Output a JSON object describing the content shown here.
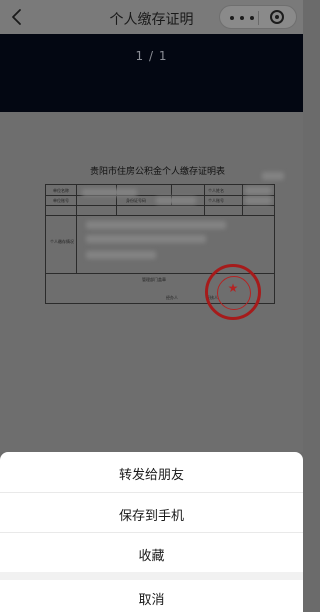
{
  "navbar": {
    "title": "个人缴存证明"
  },
  "viewer": {
    "page_counter": "1 / 1"
  },
  "document": {
    "title": "贵阳市住房公积金个人缴存证明表",
    "labels": {
      "unit_name": "单位名称",
      "unit_account": "单位账号",
      "personal_name": "个人姓名",
      "personal_account": "个人账号",
      "id_number": "身份证号码",
      "deposit_status": "个人缴存情况",
      "dept_seal": "管理部门盖章",
      "handler": "经办人",
      "reviewer": "复核人"
    },
    "seal_text": "贵阳市住房公积金管理中心"
  },
  "sheet": {
    "forward_label": "转发给朋友",
    "save_label": "保存到手机",
    "favorite_label": "收藏",
    "cancel_label": "取消"
  }
}
